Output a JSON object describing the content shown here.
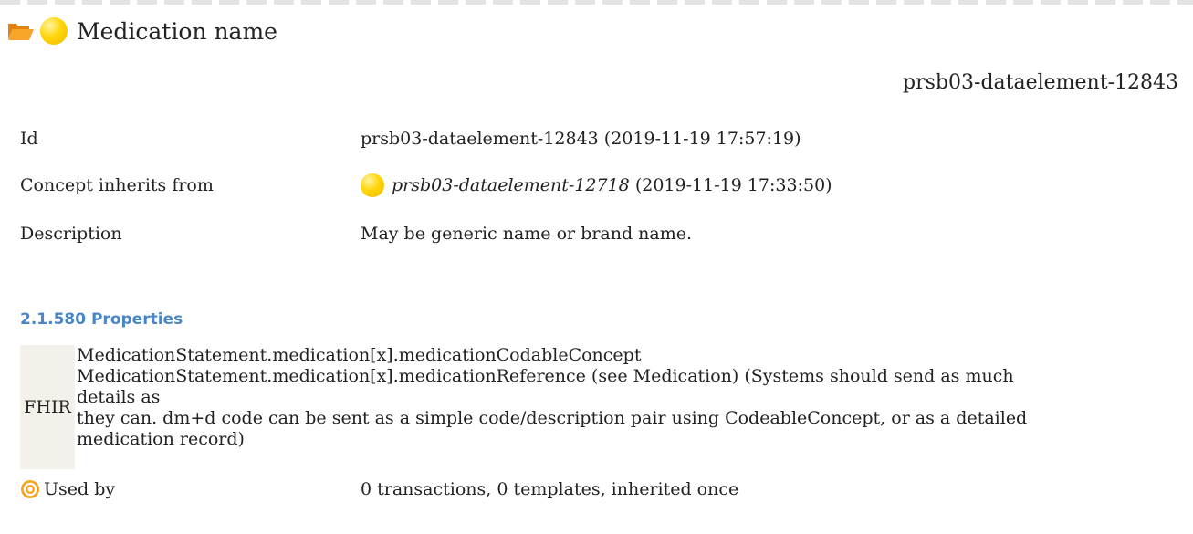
{
  "header": {
    "title": "Medication name",
    "element_id": "prsb03-dataelement-12843"
  },
  "details": {
    "id_label": "Id",
    "id_value": "prsb03-dataelement-12843 (2019-11-19 17:57:19)",
    "inherits_label": "Concept inherits from",
    "inherits_link": "prsb03-dataelement-12718",
    "inherits_date": "(2019-11-19 17:33:50)",
    "description_label": "Description",
    "description_value": "May be generic name or brand name."
  },
  "properties": {
    "heading": "2.1.580 Properties",
    "fhir_label": "FHIR",
    "lines": [
      "MedicationStatement.medication[x].medicationCodableConcept",
      "MedicationStatement.medication[x].medicationReference (see Medication) (Systems should send as much details as",
      "they can. dm+d code can be sent as a simple code/description pair using CodeableConcept, or as a detailed",
      "medication record)"
    ]
  },
  "used_by": {
    "label": "Used by",
    "value": "0 transactions, 0 templates, inherited once"
  },
  "colors": {
    "heading": "#4a86c5",
    "folder": "#f39a17",
    "concept_dot": "#ffd60a",
    "target": "#f5a623"
  },
  "icons": {
    "folder": "folder-open-icon",
    "concept": "concept-status-icon",
    "used_by": "target-icon"
  }
}
